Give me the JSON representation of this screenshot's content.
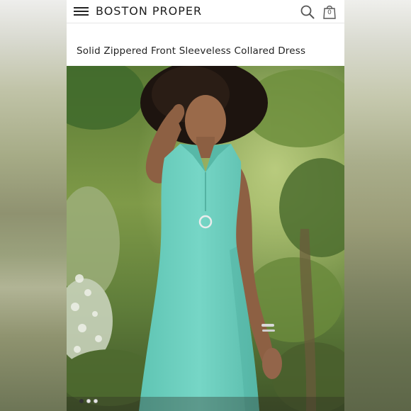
{
  "header": {
    "brand": "BOSTON PROPER",
    "menu_icon": "hamburger-menu-icon",
    "search_icon": "search-icon",
    "bag_icon": "shopping-bag-icon",
    "bag_count": "0"
  },
  "product": {
    "title": "Solid Zippered Front Sleeveless Collared Dress"
  },
  "gallery": {
    "image_count": 3,
    "active_index": 0
  },
  "colors": {
    "dress": "#6fd1c1",
    "foliage": "#5e7f3a",
    "text": "#222222"
  }
}
